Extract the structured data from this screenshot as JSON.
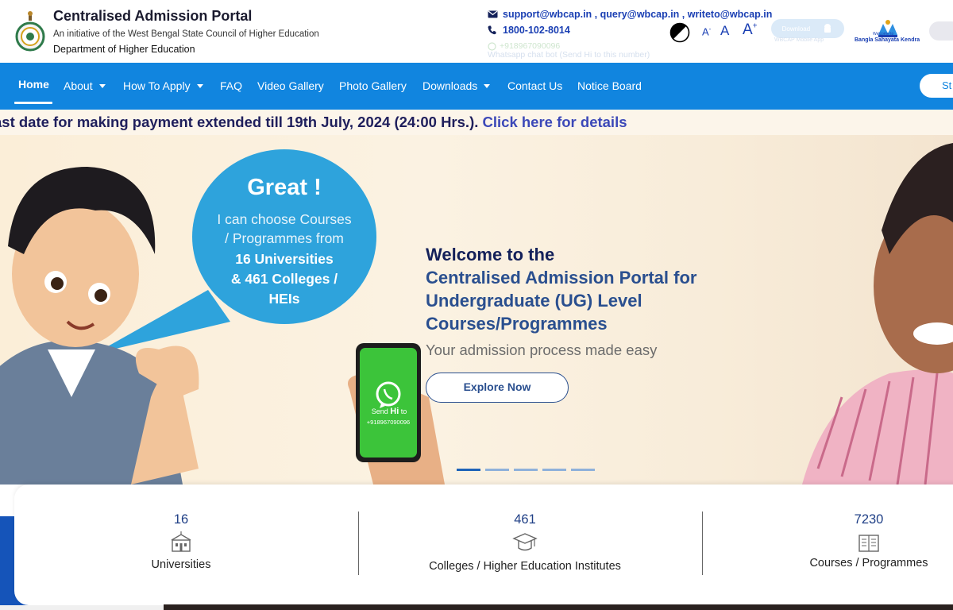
{
  "header": {
    "title": "Centralised Admission Portal",
    "subtitle": "An initiative of the West Bengal State Council of Higher Education",
    "department": "Department of Higher Education",
    "emails": "support@wbcap.in , query@wbcap.in , writeto@wbcap.in",
    "phone": "1800-102-8014",
    "whatsapp_number": "+918967090096",
    "whatsapp_caption": "Whatsapp chat bot (Send Hi to this number)",
    "font_small": "A",
    "font_normal": "A",
    "font_large": "A",
    "font_large_sup": "+",
    "app_download_label": "Download",
    "app_caption": "WBCAP Mobile App",
    "bsk_label": "Bangla Sahayata Kendra",
    "bsk_welcome": "Welcome to"
  },
  "nav": {
    "items": [
      {
        "label": "Home",
        "has_caret": false
      },
      {
        "label": "About",
        "has_caret": true
      },
      {
        "label": "How To Apply",
        "has_caret": true
      },
      {
        "label": "FAQ",
        "has_caret": false
      },
      {
        "label": "Video Gallery",
        "has_caret": false
      },
      {
        "label": "Photo Gallery",
        "has_caret": false
      },
      {
        "label": "Downloads",
        "has_caret": true
      },
      {
        "label": "Contact Us",
        "has_caret": false
      },
      {
        "label": "Notice Board",
        "has_caret": false
      }
    ],
    "cta_label": "St"
  },
  "marquee": {
    "text": "ast date for making payment extended till 19th July, 2024 (24:00 Hrs.).",
    "link": " Click here for details"
  },
  "hero": {
    "bubble_title": "Great !",
    "bubble_text": [
      "I can choose Courses",
      "/ Programmes from"
    ],
    "bubble_universities": "16 Universities",
    "bubble_colleges": "& 461 Colleges /",
    "bubble_heis": "HEIs",
    "phone_send": "Send",
    "phone_hi": "Hi",
    "phone_to": "to",
    "phone_number": "+918967090096",
    "welcome": "Welcome to the",
    "heading": "Centralised Admission Portal for Undergraduate (UG) Level Courses/Programmes",
    "tagline": "Your admission process made easy",
    "explore_label": "Explore Now",
    "slide_count": 5,
    "active_slide": 1
  },
  "stats": [
    {
      "value": "16",
      "label": "Universities",
      "icon": "university-building-icon"
    },
    {
      "value": "461",
      "label": "Colleges / Higher Education Institutes",
      "icon": "graduation-cap-icon"
    },
    {
      "value": "7230",
      "label": "Courses / Programmes",
      "icon": "book-icon"
    }
  ],
  "colors": {
    "nav_bg": "#1185df",
    "title_navy": "#14215a",
    "heading_blue": "#2a4f8f",
    "link_blue": "#1a3fb3",
    "bubble_blue": "#2ea3dc",
    "phone_green": "#3cc43a"
  }
}
